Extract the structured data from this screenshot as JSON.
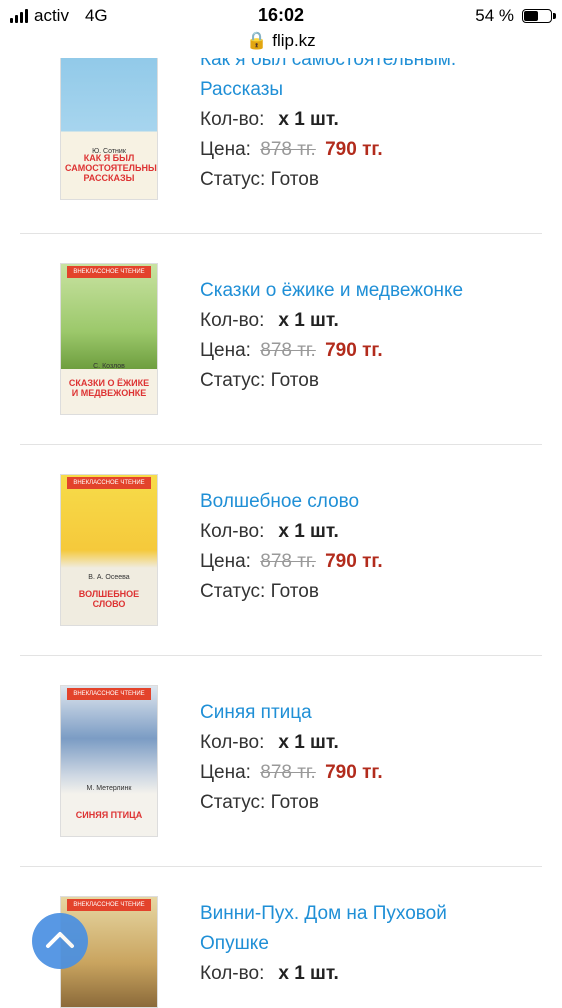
{
  "status_bar": {
    "carrier": "activ",
    "network": "4G",
    "time": "16:02",
    "url": "flip.kz",
    "battery": "54 %"
  },
  "labels": {
    "qty": "Кол-во:",
    "price": "Цена:",
    "status": "Статус:"
  },
  "items": [
    {
      "title_line1": "Как я был самостоятельным.",
      "title_line2": "Рассказы",
      "qty": "x 1 шт.",
      "old_price": "878 тг.",
      "new_price": "790 тг.",
      "status": "Готов",
      "cover": {
        "author": "Ю. Сотник",
        "title": "КАК Я БЫЛ САМОСТОЯТЕЛЬНЫМ РАССКАЗЫ",
        "badge": ""
      }
    },
    {
      "title_line1": "Сказки о ёжике и медвежонке",
      "qty": "x 1 шт.",
      "old_price": "878 тг.",
      "new_price": "790 тг.",
      "status": "Готов",
      "cover": {
        "author": "С. Козлов",
        "title": "СКАЗКИ О ЁЖИКЕ И МЕДВЕЖОНКЕ",
        "badge": "ВНЕКЛАССНОЕ ЧТЕНИЕ"
      }
    },
    {
      "title_line1": "Волшебное слово",
      "qty": "x 1 шт.",
      "old_price": "878 тг.",
      "new_price": "790 тг.",
      "status": "Готов",
      "cover": {
        "author": "В. А. Осеева",
        "title": "ВОЛШЕБНОЕ СЛОВО",
        "badge": "ВНЕКЛАССНОЕ ЧТЕНИЕ"
      }
    },
    {
      "title_line1": "Синяя птица",
      "qty": "x 1 шт.",
      "old_price": "878 тг.",
      "new_price": "790 тг.",
      "status": "Готов",
      "cover": {
        "author": "М. Метерлинк",
        "title": "СИНЯЯ ПТИЦА",
        "badge": "ВНЕКЛАССНОЕ ЧТЕНИЕ"
      }
    },
    {
      "title_line1": "Винни-Пух. Дом на Пуховой",
      "title_line2": "Опушке",
      "qty": "x 1 шт.",
      "cover": {
        "badge": "ВНЕКЛАССНОЕ ЧТЕНИЕ"
      }
    }
  ]
}
